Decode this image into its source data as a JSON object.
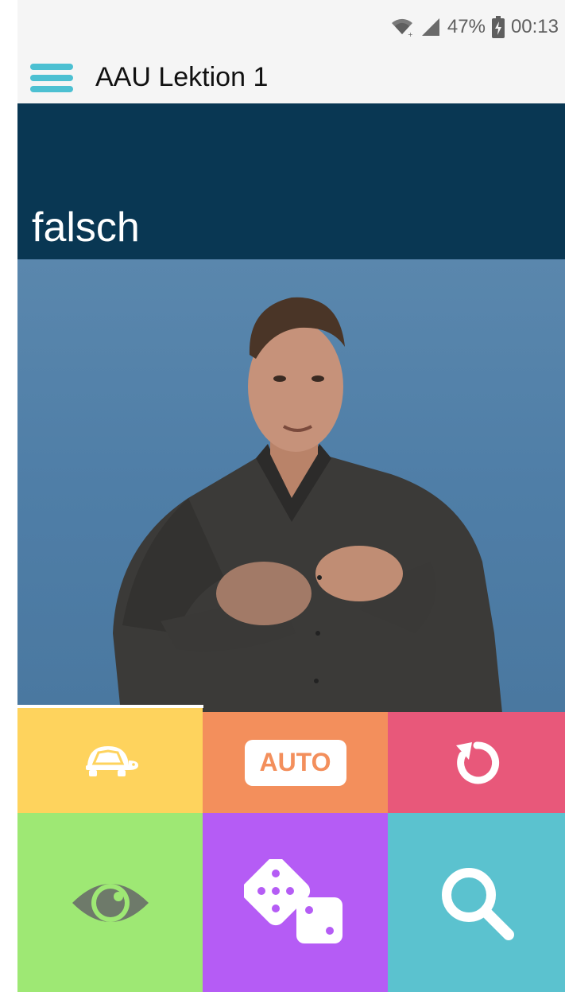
{
  "status_bar": {
    "battery_percent": "47%",
    "time": "00:13",
    "icons": [
      "wifi-icon",
      "signal-icon",
      "battery-icon"
    ]
  },
  "app_bar": {
    "title": "AAU Lektion 1",
    "menu_icon": "hamburger-menu-icon"
  },
  "word_card": {
    "word": "falsch"
  },
  "video": {
    "progress": 0.34
  },
  "controls": {
    "slow_icon": "turtle-icon",
    "auto_label": "AUTO",
    "replay_icon": "replay-icon",
    "reveal_icon": "eye-icon",
    "random_icon": "dice-icon",
    "search_icon": "search-icon"
  },
  "colors": {
    "accent": "#4cc0d2",
    "banner": "#093753",
    "slow_tile": "#fed35d",
    "auto_tile": "#f38f5c",
    "replay_tile": "#e8587a",
    "reveal_tile": "#9ee874",
    "random_tile": "#b55cf5",
    "search_tile": "#5bc2cf"
  }
}
